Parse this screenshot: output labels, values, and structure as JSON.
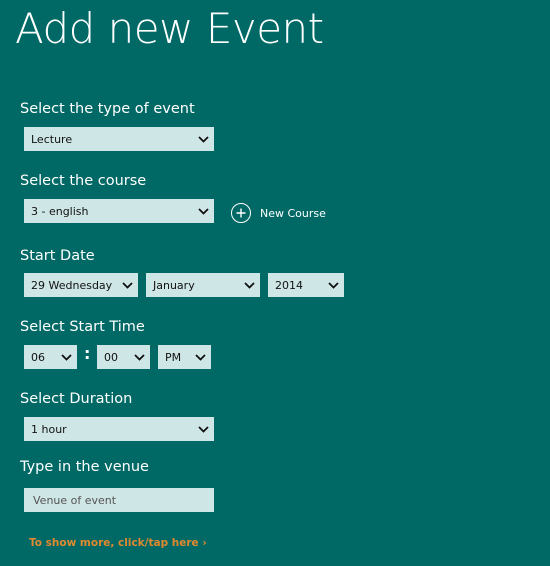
{
  "page": {
    "title": "Add new Event"
  },
  "event_type": {
    "label": "Select the type of event",
    "value": "Lecture"
  },
  "course": {
    "label": "Select the course",
    "value": "3 - english",
    "new_course_label": "New Course"
  },
  "start_date": {
    "label": "Start Date",
    "day": "29 Wednesday",
    "month": "January",
    "year": "2014"
  },
  "start_time": {
    "label": "Select Start Time",
    "hour": "06",
    "separator": ":",
    "minute": "00",
    "ampm": "PM"
  },
  "duration": {
    "label": "Select Duration",
    "value": "1 hour"
  },
  "venue": {
    "label": "Type in the venue",
    "placeholder": "Venue of event"
  },
  "more": {
    "link_text": "To show more, click/tap here ›"
  },
  "colors": {
    "background": "#006966",
    "field": "#cfe6e6",
    "link": "#e1892f"
  }
}
